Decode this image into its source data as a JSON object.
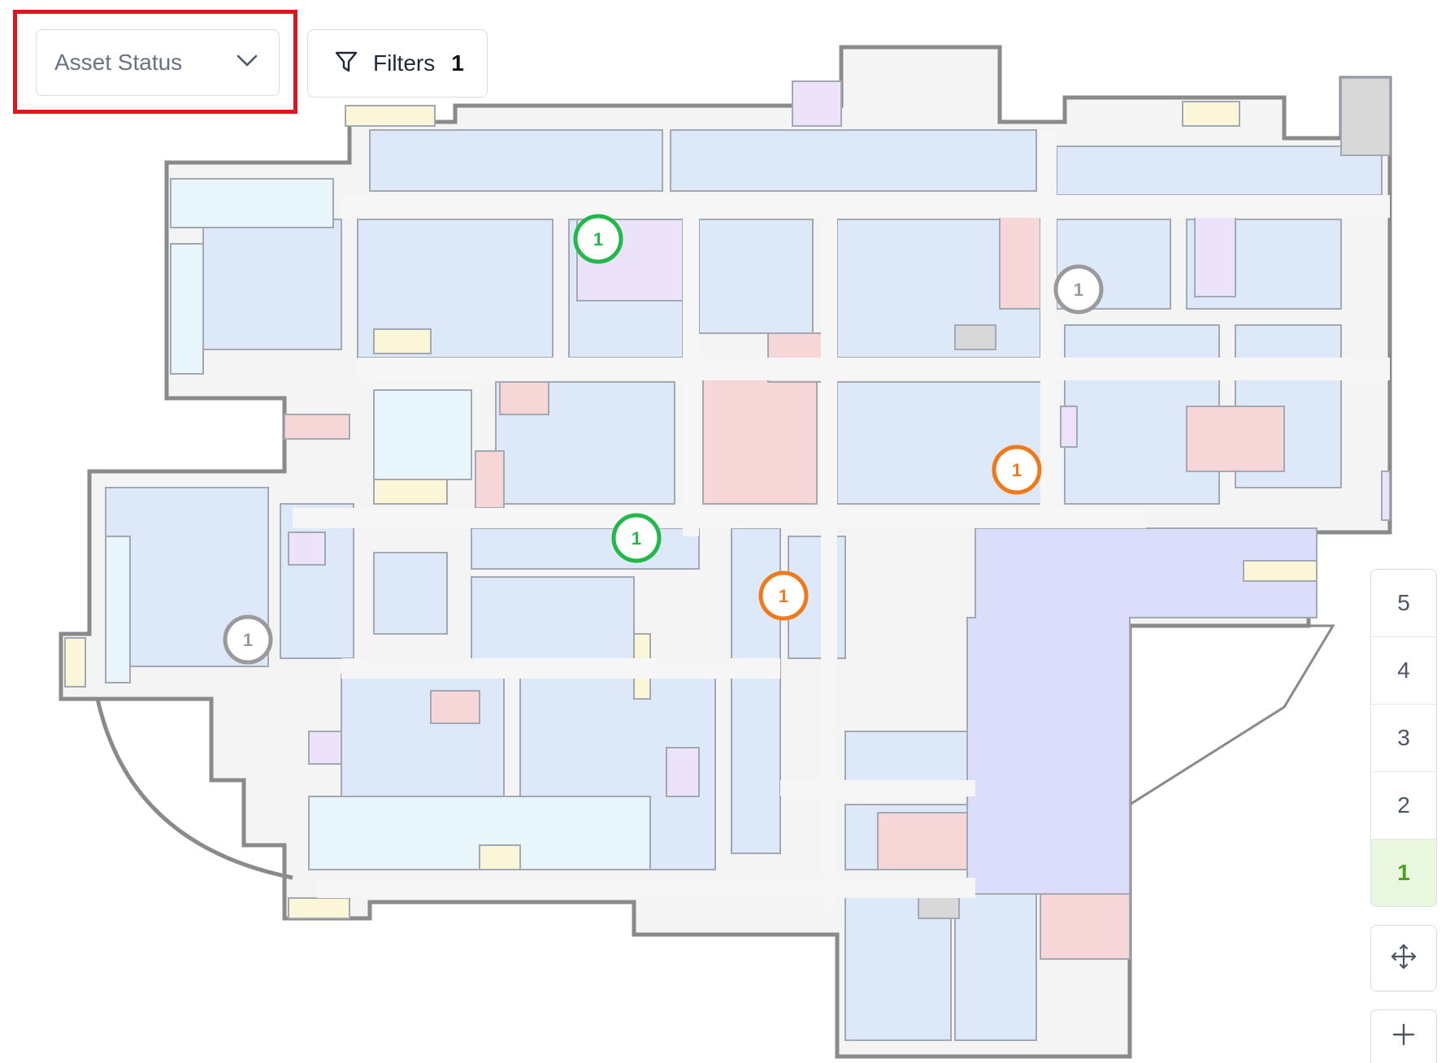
{
  "toolbar": {
    "asset_status_label": "Asset Status",
    "filters_label": "Filters",
    "filters_count": "1"
  },
  "floors": [
    {
      "label": "5",
      "active": false
    },
    {
      "label": "4",
      "active": false
    },
    {
      "label": "3",
      "active": false
    },
    {
      "label": "2",
      "active": false
    },
    {
      "label": "1",
      "active": true
    }
  ],
  "map_controls": {
    "pan_icon": "move-arrows-icon",
    "zoom_in_icon": "plus-icon"
  },
  "markers": [
    {
      "count": "1",
      "status": "green"
    },
    {
      "count": "1",
      "status": "gray"
    },
    {
      "count": "1",
      "status": "orange"
    },
    {
      "count": "1",
      "status": "green"
    },
    {
      "count": "1",
      "status": "orange"
    },
    {
      "count": "1",
      "status": "gray"
    }
  ],
  "colors": {
    "green": "#22b84a",
    "orange": "#f07a1a",
    "gray": "#9a9a9a",
    "highlight": "#e0141e",
    "active_floor": "#48a31b"
  }
}
